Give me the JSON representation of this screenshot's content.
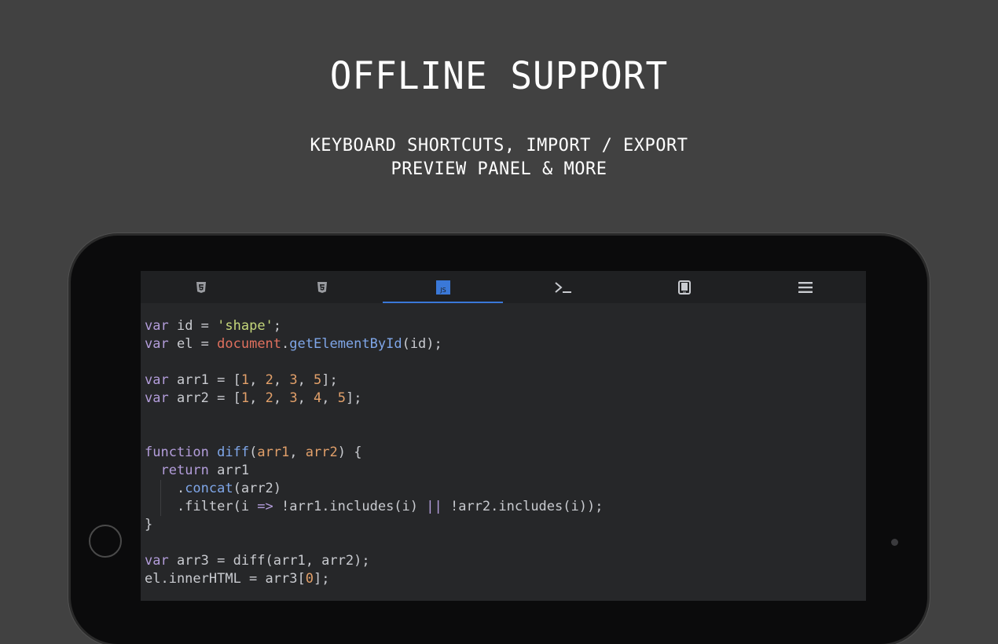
{
  "hero": {
    "title": "OFFLINE SUPPORT",
    "subtitle_line1": "KEYBOARD SHORTCUTS, IMPORT / EXPORT",
    "subtitle_line2": "PREVIEW PANEL & MORE"
  },
  "tabs": [
    {
      "icon": "html5-icon",
      "active": false
    },
    {
      "icon": "css3-icon",
      "active": false
    },
    {
      "icon": "js-icon",
      "label": "JS",
      "active": true
    },
    {
      "icon": "terminal-icon",
      "active": false
    },
    {
      "icon": "tablet-icon",
      "active": false
    },
    {
      "icon": "menu-icon",
      "active": false
    }
  ],
  "colors": {
    "accent": "#3a78d8",
    "keyword": "#b39ddb",
    "string": "#c5d77b",
    "object": "#e0705e",
    "function": "#7fa6e8",
    "number": "#e2a06a",
    "text": "#c9cbd0"
  },
  "code": {
    "lines": [
      [
        {
          "t": "var",
          "c": "kw"
        },
        {
          "t": " id = "
        },
        {
          "t": "'shape'",
          "c": "str"
        },
        {
          "t": ";"
        }
      ],
      [
        {
          "t": "var",
          "c": "kw"
        },
        {
          "t": " el = "
        },
        {
          "t": "document",
          "c": "obj"
        },
        {
          "t": "."
        },
        {
          "t": "getElementById",
          "c": "fn"
        },
        {
          "t": "(id);"
        }
      ],
      [],
      [
        {
          "t": "var",
          "c": "kw"
        },
        {
          "t": " arr1 = ["
        },
        {
          "t": "1",
          "c": "num"
        },
        {
          "t": ", "
        },
        {
          "t": "2",
          "c": "num"
        },
        {
          "t": ", "
        },
        {
          "t": "3",
          "c": "num"
        },
        {
          "t": ", "
        },
        {
          "t": "5",
          "c": "num"
        },
        {
          "t": "];"
        }
      ],
      [
        {
          "t": "var",
          "c": "kw"
        },
        {
          "t": " arr2 = ["
        },
        {
          "t": "1",
          "c": "num"
        },
        {
          "t": ", "
        },
        {
          "t": "2",
          "c": "num"
        },
        {
          "t": ", "
        },
        {
          "t": "3",
          "c": "num"
        },
        {
          "t": ", "
        },
        {
          "t": "4",
          "c": "num"
        },
        {
          "t": ", "
        },
        {
          "t": "5",
          "c": "num"
        },
        {
          "t": "];"
        }
      ],
      [],
      [],
      [
        {
          "t": "function",
          "c": "kw"
        },
        {
          "t": " "
        },
        {
          "t": "diff",
          "c": "fn"
        },
        {
          "t": "("
        },
        {
          "t": "arr1",
          "c": "param"
        },
        {
          "t": ", "
        },
        {
          "t": "arr2",
          "c": "param"
        },
        {
          "t": ") {"
        }
      ],
      [
        {
          "t": "  "
        },
        {
          "t": "return",
          "c": "kw"
        },
        {
          "t": " arr1"
        }
      ],
      [
        {
          "t": "    ."
        },
        {
          "t": "concat",
          "c": "fn"
        },
        {
          "t": "(arr2)"
        }
      ],
      [
        {
          "t": "    .filter(i "
        },
        {
          "t": "=>",
          "c": "kw"
        },
        {
          "t": " !arr1.includes(i) "
        },
        {
          "t": "||",
          "c": "kw"
        },
        {
          "t": " !arr2.includes(i));"
        }
      ],
      [
        {
          "t": "}"
        }
      ],
      [],
      [
        {
          "t": "var",
          "c": "kw"
        },
        {
          "t": " arr3 = diff(arr1, arr2);"
        }
      ],
      [
        {
          "t": "el.innerHTML = arr3["
        },
        {
          "t": "0",
          "c": "num"
        },
        {
          "t": "];"
        }
      ]
    ]
  }
}
